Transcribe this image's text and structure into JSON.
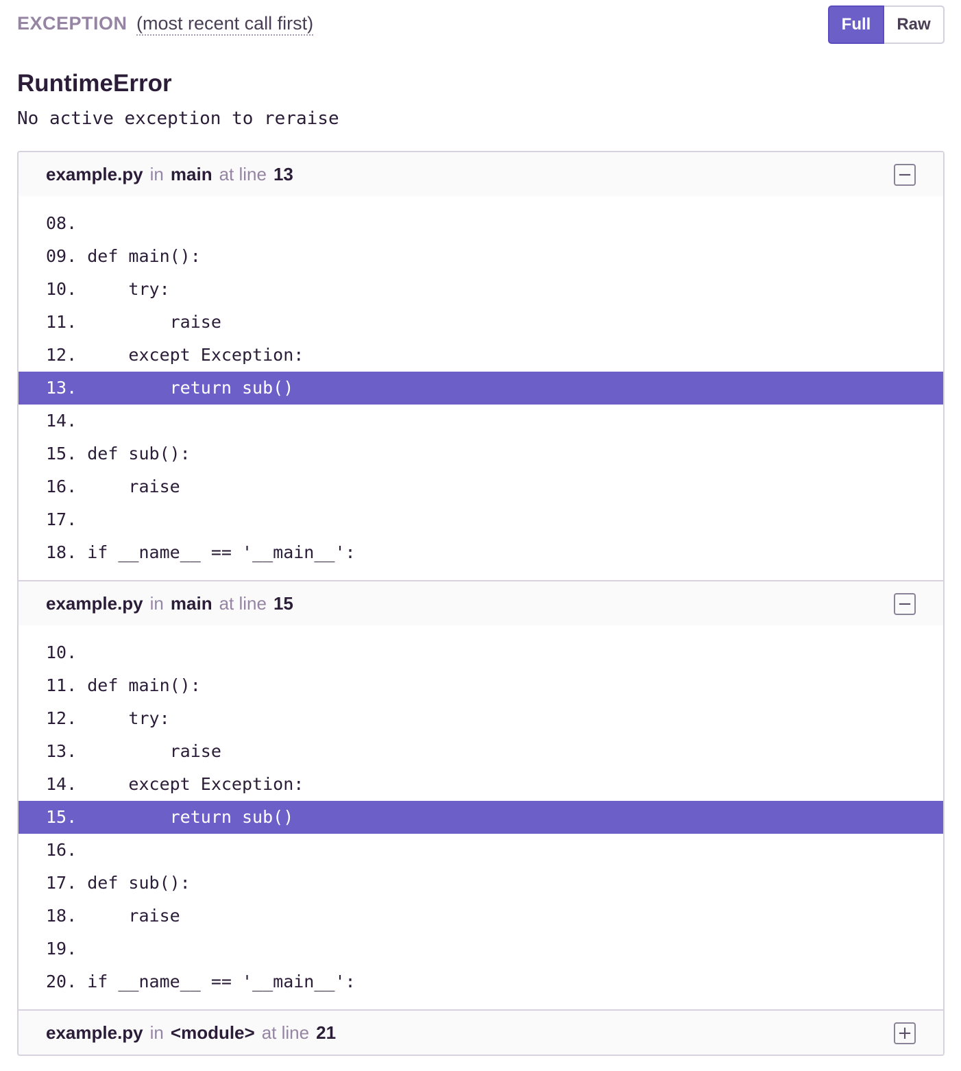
{
  "header": {
    "label": "EXCEPTION",
    "order_note": "(most recent call first)",
    "view_full_label": "Full",
    "view_raw_label": "Raw",
    "active_view": "Full"
  },
  "error": {
    "type": "RuntimeError",
    "message": "No active exception to reraise"
  },
  "colors": {
    "accent": "#6c5fc7",
    "muted_text": "#9585a3",
    "border": "#d7d2dd"
  },
  "frames": [
    {
      "file": "example.py",
      "in_label": "in",
      "function": "main",
      "at_line_label": "at line",
      "line": "13",
      "toggle_icon": "minus-icon",
      "toggle_glyph": "−",
      "code": [
        {
          "num": "08.",
          "text": ""
        },
        {
          "num": "09.",
          "text": "def main():"
        },
        {
          "num": "10.",
          "text": "    try:"
        },
        {
          "num": "11.",
          "text": "        raise"
        },
        {
          "num": "12.",
          "text": "    except Exception:"
        },
        {
          "num": "13.",
          "text": "        return sub()"
        },
        {
          "num": "14.",
          "text": ""
        },
        {
          "num": "15.",
          "text": "def sub():"
        },
        {
          "num": "16.",
          "text": "    raise"
        },
        {
          "num": "17.",
          "text": ""
        },
        {
          "num": "18.",
          "text": "if __name__ == '__main__':"
        }
      ],
      "active_index": 5
    },
    {
      "file": "example.py",
      "in_label": "in",
      "function": "main",
      "at_line_label": "at line",
      "line": "15",
      "toggle_icon": "minus-icon",
      "toggle_glyph": "−",
      "code": [
        {
          "num": "10.",
          "text": ""
        },
        {
          "num": "11.",
          "text": "def main():"
        },
        {
          "num": "12.",
          "text": "    try:"
        },
        {
          "num": "13.",
          "text": "        raise"
        },
        {
          "num": "14.",
          "text": "    except Exception:"
        },
        {
          "num": "15.",
          "text": "        return sub()"
        },
        {
          "num": "16.",
          "text": ""
        },
        {
          "num": "17.",
          "text": "def sub():"
        },
        {
          "num": "18.",
          "text": "    raise"
        },
        {
          "num": "19.",
          "text": ""
        },
        {
          "num": "20.",
          "text": "if __name__ == '__main__':"
        }
      ],
      "active_index": 5
    },
    {
      "file": "example.py",
      "in_label": "in",
      "function": "<module>",
      "at_line_label": "at line",
      "line": "21",
      "toggle_icon": "plus-icon",
      "toggle_glyph": "+",
      "code": [],
      "active_index": -1
    }
  ]
}
